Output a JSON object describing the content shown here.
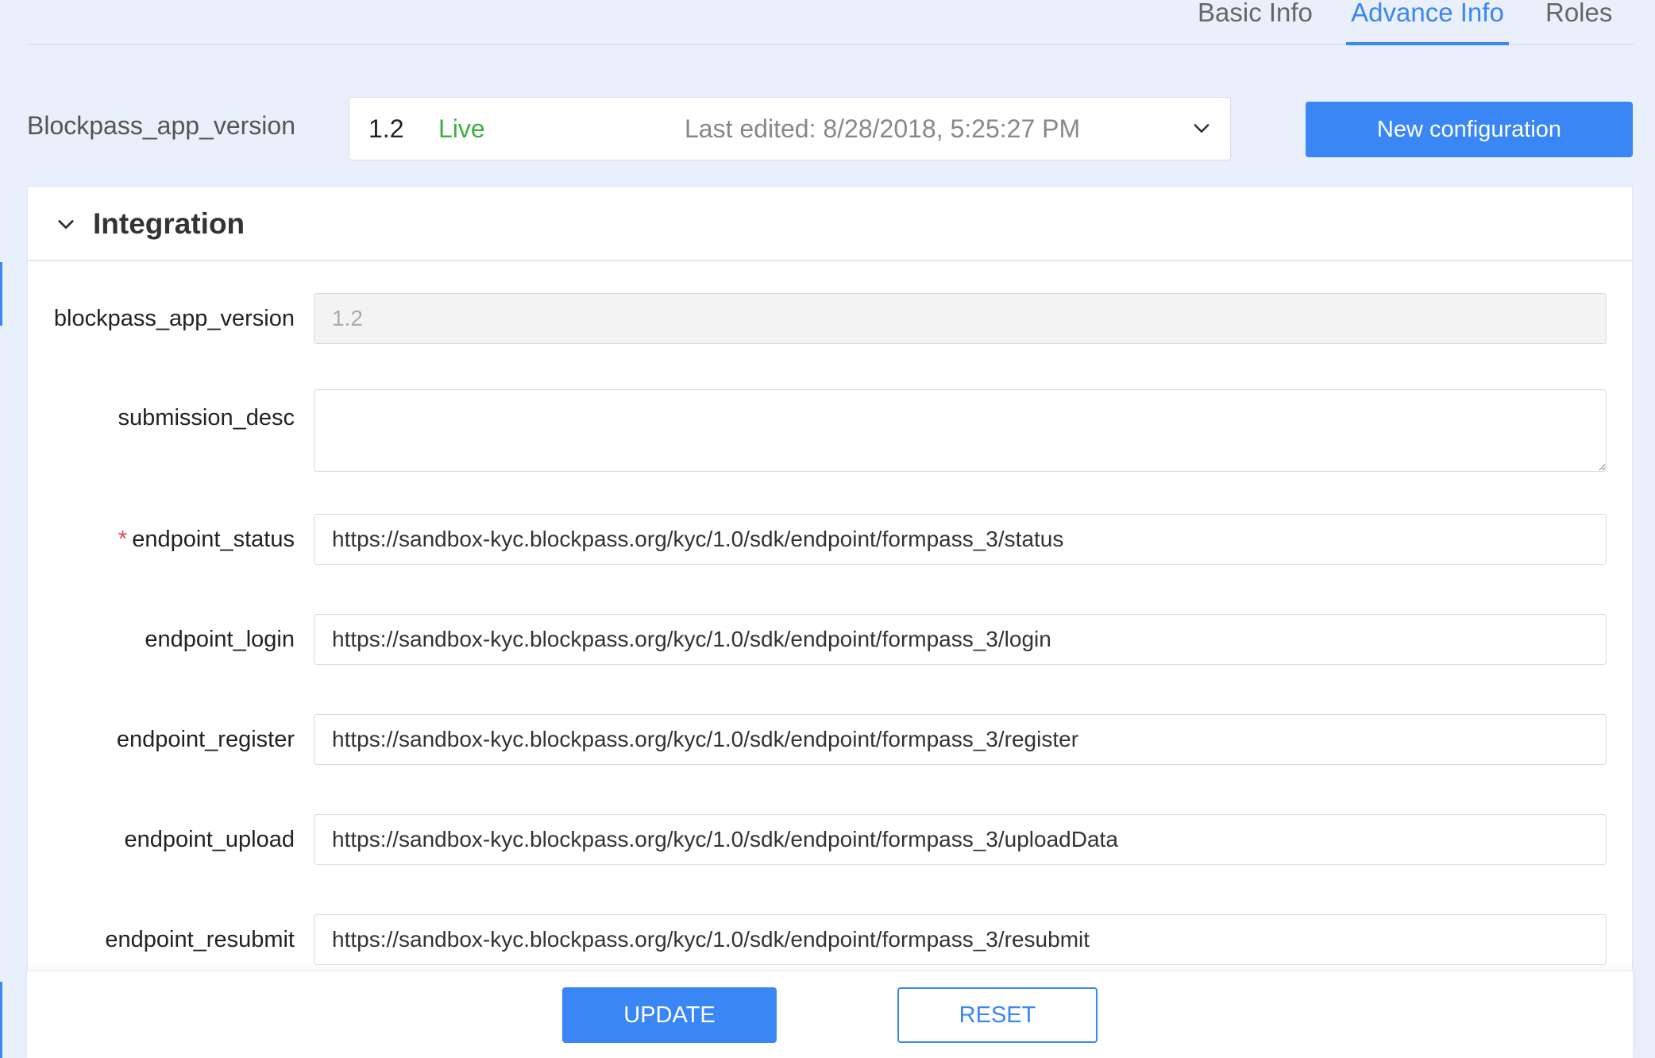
{
  "tabs": [
    {
      "label": "Basic Info",
      "active": false
    },
    {
      "label": "Advance Info",
      "active": true
    },
    {
      "label": "Roles",
      "active": false
    }
  ],
  "version_row": {
    "label": "Blockpass_app_version",
    "selected_version": "1.2",
    "status": "Live",
    "last_edited": "Last edited: 8/28/2018, 5:25:27 PM",
    "new_config_label": "New configuration"
  },
  "panel": {
    "title": "Integration"
  },
  "fields": {
    "blockpass_app_version": {
      "label": "blockpass_app_version",
      "value": "1.2"
    },
    "submission_desc": {
      "label": "submission_desc",
      "value": ""
    },
    "endpoint_status": {
      "label": "endpoint_status",
      "required_mark": "*",
      "value": "https://sandbox-kyc.blockpass.org/kyc/1.0/sdk/endpoint/formpass_3/status"
    },
    "endpoint_login": {
      "label": "endpoint_login",
      "value": "https://sandbox-kyc.blockpass.org/kyc/1.0/sdk/endpoint/formpass_3/login"
    },
    "endpoint_register": {
      "label": "endpoint_register",
      "value": "https://sandbox-kyc.blockpass.org/kyc/1.0/sdk/endpoint/formpass_3/register"
    },
    "endpoint_upload": {
      "label": "endpoint_upload",
      "value": "https://sandbox-kyc.blockpass.org/kyc/1.0/sdk/endpoint/formpass_3/uploadData"
    },
    "endpoint_resubmit": {
      "label": "endpoint_resubmit",
      "value": "https://sandbox-kyc.blockpass.org/kyc/1.0/sdk/endpoint/formpass_3/resubmit"
    }
  },
  "actions": {
    "update_label": "UPDATE",
    "reset_label": "RESET"
  },
  "colors": {
    "accent": "#3a86f5",
    "live": "#3cb043",
    "required": "#e5484d",
    "background": "#eaf0fb"
  },
  "icons": {
    "select_chevron": "chevron-down-icon",
    "panel_chevron": "chevron-down-icon"
  }
}
